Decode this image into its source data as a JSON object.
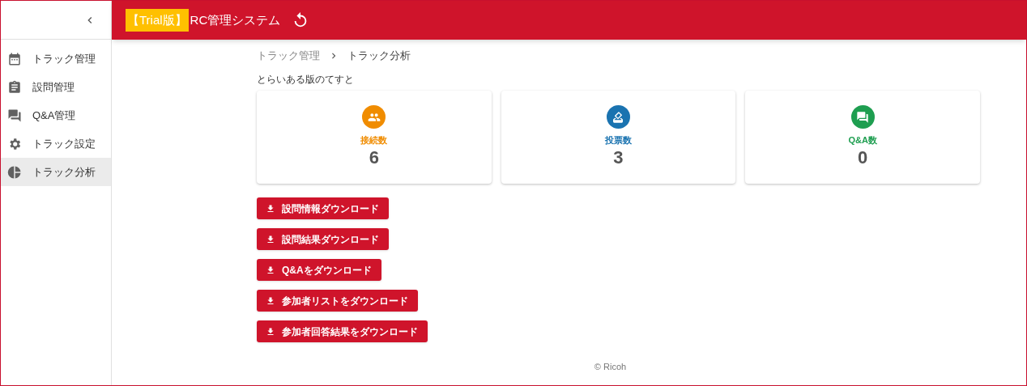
{
  "header": {
    "badge": "【Trial版】",
    "title": "RC管理システム"
  },
  "sidebar": {
    "items": [
      {
        "label": "トラック管理",
        "kind": "calendar",
        "selected": false
      },
      {
        "label": "設問管理",
        "kind": "clipboard",
        "selected": false
      },
      {
        "label": "Q&A管理",
        "kind": "chat",
        "selected": false
      },
      {
        "label": "トラック設定",
        "kind": "gear",
        "selected": false
      },
      {
        "label": "トラック分析",
        "kind": "pie",
        "selected": true
      }
    ]
  },
  "breadcrumb": [
    "トラック管理",
    "トラック分析"
  ],
  "track_name": "とらいある版のてすと",
  "stats": [
    {
      "label": "接続数",
      "value": "6",
      "kind": "people",
      "color": "#f08c00"
    },
    {
      "label": "投票数",
      "value": "3",
      "kind": "vote",
      "color": "#1a73b0"
    },
    {
      "label": "Q&A数",
      "value": "0",
      "kind": "chat",
      "color": "#1e9e50"
    }
  ],
  "buttons": [
    "設問情報ダウンロード",
    "設問結果ダウンロード",
    "Q&Aをダウンロード",
    "参加者リストをダウンロード",
    "参加者回答結果をダウンロード"
  ],
  "footer": "© Ricoh"
}
